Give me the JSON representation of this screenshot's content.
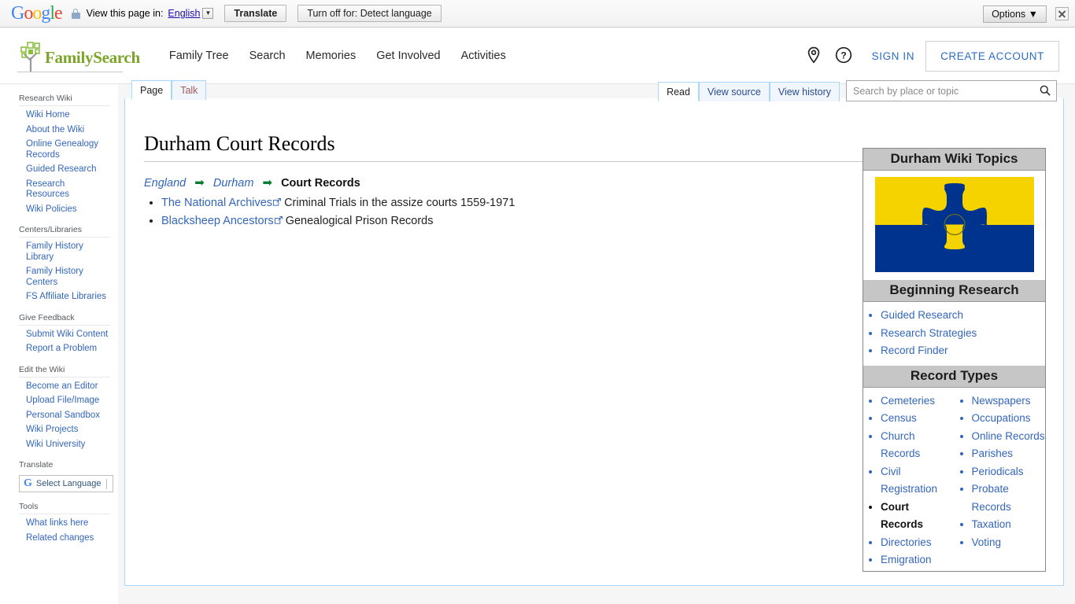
{
  "translate_bar": {
    "logo": "Google",
    "prompt": "View this page in:",
    "language": "English",
    "caret": "▼",
    "translate_label": "Translate",
    "turn_off_label": "Turn off for: Detect language",
    "options_label": "Options ▼",
    "close_icon": "close-icon"
  },
  "site_header": {
    "brand": "FamilySearch",
    "nav": [
      {
        "label": "Family Tree"
      },
      {
        "label": "Search"
      },
      {
        "label": "Memories"
      },
      {
        "label": "Get Involved"
      },
      {
        "label": "Activities"
      }
    ],
    "location_icon": "location-pin-icon",
    "help_icon": "help-circle-icon",
    "sign_in": "SIGN IN",
    "create_account": "CREATE ACCOUNT"
  },
  "sidebar": {
    "sections": [
      {
        "heading": "Research Wiki",
        "items": [
          "Wiki Home",
          "About the Wiki",
          "Online Genealogy Records",
          "Guided Research",
          "Research Resources",
          "Wiki Policies"
        ]
      },
      {
        "heading": "Centers/Libraries",
        "items": [
          "Family History Library",
          "Family History Centers",
          "FS Affiliate Libraries"
        ]
      },
      {
        "heading": "Give Feedback",
        "items": [
          "Submit Wiki Content",
          "Report a Problem"
        ]
      },
      {
        "heading": "Edit the Wiki",
        "items": [
          "Become an Editor",
          "Upload File/Image",
          "Personal Sandbox",
          "Wiki Projects",
          "Wiki University"
        ]
      }
    ],
    "translate_heading": "Translate",
    "translate_widget_label": "Select Language",
    "tools_heading": "Tools",
    "tools_items": [
      "What links here",
      "Related changes"
    ]
  },
  "tabs": {
    "left": [
      {
        "label": "Page",
        "selected": true
      },
      {
        "label": "Talk",
        "selected": false
      }
    ],
    "right": [
      {
        "label": "Read",
        "selected": true
      },
      {
        "label": "View source",
        "selected": false
      },
      {
        "label": "View history",
        "selected": false
      }
    ]
  },
  "search": {
    "placeholder": "Search by place or topic",
    "value": "",
    "icon": "search-icon"
  },
  "article": {
    "title": "Durham Court Records",
    "breadcrumb": {
      "first": "England",
      "arrow": "➡",
      "second": "Durham",
      "current": "Court Records"
    },
    "links": [
      {
        "link_text": "The National Archives",
        "rest": " Criminal Trials in the assize courts 1559-1971"
      },
      {
        "link_text": "Blacksheep Ancestors",
        "rest": " Genealogical Prison Records"
      }
    ]
  },
  "infobox": {
    "title": "Durham Wiki Topics",
    "flag_alt": "durham-flag",
    "flag_colors": {
      "yellow": "#f5d300",
      "blue": "#00338d"
    },
    "beginning_research_heading": "Beginning Research",
    "beginning_research_items": [
      "Guided Research",
      "Research Strategies",
      "Record Finder"
    ],
    "record_types_heading": "Record Types",
    "record_types_left": [
      {
        "label": "Cemeteries",
        "current": false
      },
      {
        "label": "Census",
        "current": false
      },
      {
        "label": "Church Records",
        "current": false
      },
      {
        "label": "Civil Registration",
        "current": false
      },
      {
        "label": "Court Records",
        "current": true
      },
      {
        "label": "Directories",
        "current": false
      },
      {
        "label": "Emigration",
        "current": false
      }
    ],
    "record_types_right": [
      {
        "label": "Newspapers",
        "current": false
      },
      {
        "label": "Occupations",
        "current": false
      },
      {
        "label": "Online Records",
        "current": false
      },
      {
        "label": "Parishes",
        "current": false
      },
      {
        "label": "Periodicals",
        "current": false
      },
      {
        "label": "Probate Records",
        "current": false
      },
      {
        "label": "Taxation",
        "current": false
      },
      {
        "label": "Voting",
        "current": false
      }
    ]
  }
}
